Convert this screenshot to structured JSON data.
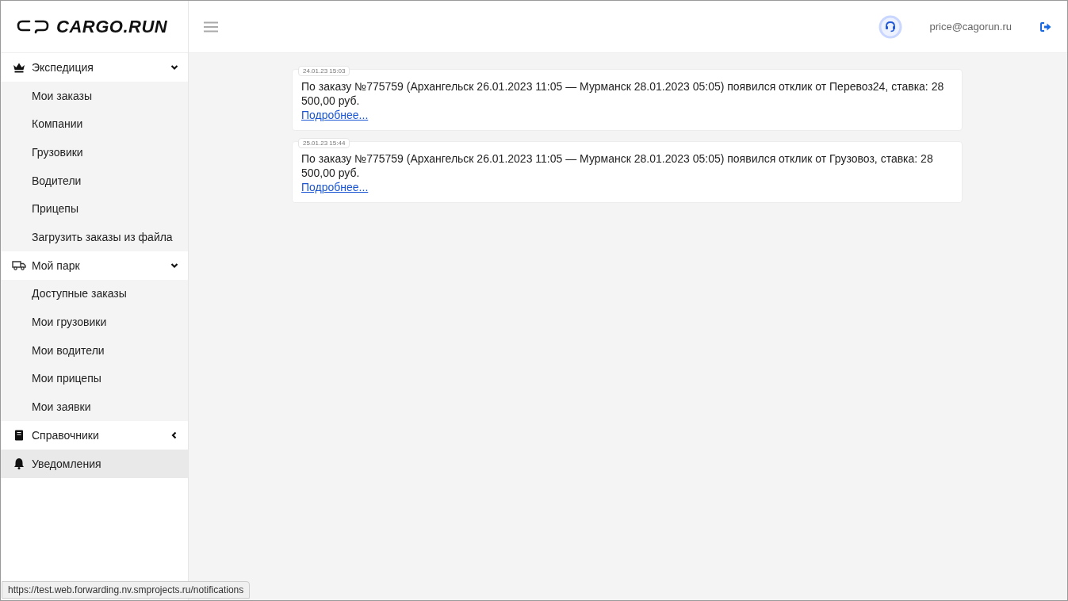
{
  "logo": {
    "text": "CARGO.RUN"
  },
  "header": {
    "user_email": "price@cagorun.ru"
  },
  "sidebar": {
    "items": [
      {
        "label": "Экспедиция",
        "expanded": true,
        "selected": false,
        "children": [
          {
            "label": "Мои заказы",
            "selected": false
          },
          {
            "label": "Компании",
            "selected": false
          },
          {
            "label": "Грузовики",
            "selected": false
          },
          {
            "label": "Водители",
            "selected": false
          },
          {
            "label": "Прицепы",
            "selected": false
          },
          {
            "label": "Загрузить заказы из файла",
            "selected": false
          }
        ]
      },
      {
        "label": "Мой парк",
        "expanded": true,
        "selected": false,
        "children": [
          {
            "label": "Доступные заказы",
            "selected": false
          },
          {
            "label": "Мои грузовики",
            "selected": false
          },
          {
            "label": "Мои водители",
            "selected": false
          },
          {
            "label": "Мои прицепы",
            "selected": false
          },
          {
            "label": "Мои заявки",
            "selected": false
          }
        ]
      },
      {
        "label": "Справочники",
        "expanded": false,
        "selected": false
      },
      {
        "label": "Уведомления",
        "selected": true
      }
    ]
  },
  "notifications": [
    {
      "time": "24.01.23 15:03",
      "text": "По заказу №775759 (Архангельск 26.01.2023 11:05 — Мурманск 28.01.2023 05:05) появился отклик от Перевоз24, ставка: 28 500,00 руб.",
      "link": "Подробнее..."
    },
    {
      "time": "25.01.23 15:44",
      "text": "По заказу №775759 (Архангельск 26.01.2023 11:05 — Мурманск 28.01.2023 05:05) появился отклик от Грузовоз, ставка: 28 500,00 руб.",
      "link": "Подробнее..."
    }
  ],
  "status_bar": {
    "url": "https://test.web.forwarding.nv.smprojects.ru/notifications"
  }
}
